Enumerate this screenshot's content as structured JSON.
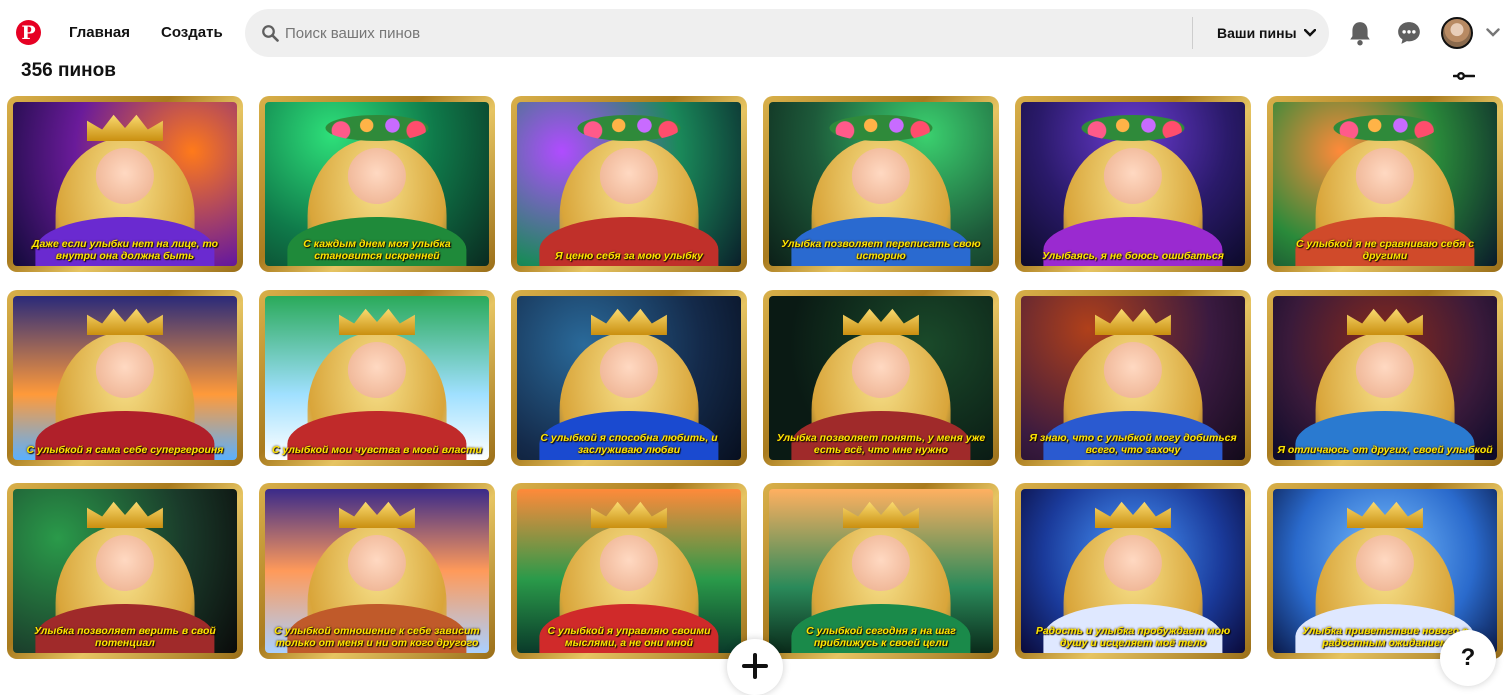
{
  "header": {
    "logo_icon": "pinterest-logo",
    "nav_home": "Главная",
    "nav_create": "Создать",
    "search_placeholder": "Поиск ваших пинов",
    "search_scope": "Ваши пины",
    "icons": [
      "bell-icon",
      "chat-icon",
      "avatar",
      "chevron-down-icon"
    ]
  },
  "board": {
    "pin_count": "356 пинов"
  },
  "pins": [
    {
      "caption": "Даже если улыбки нет на лице, то внутри она должна быть"
    },
    {
      "caption": "С каждым днем моя улыбка становится искренней"
    },
    {
      "caption": "Я ценю себя за мою улыбку"
    },
    {
      "caption": "Улыбка позволяет переписать свою историю"
    },
    {
      "caption": "Улыбаясь, я не боюсь ошибаться"
    },
    {
      "caption": "С улыбкой я не сравниваю себя с другими"
    },
    {
      "caption": "С улыбкой я сама себе супергероиня"
    },
    {
      "caption": "С улыбкой мои чувства в моей власти"
    },
    {
      "caption": "С улыбкой я способна любить, и заслуживаю любви"
    },
    {
      "caption": "Улыбка позволяет понять, у меня уже есть всё, что мне нужно"
    },
    {
      "caption": "Я знаю, что с улыбкой могу добиться всего, что захочу"
    },
    {
      "caption": "Я отличаюсь от других, своей улыбкой"
    },
    {
      "caption": "Улыбка позволяет верить в свой потенциал"
    },
    {
      "caption": "С улыбкой отношение к себе зависит только от меня и ни от кого другого"
    },
    {
      "caption": "С улыбкой я управляю своими мыслями, а не они мной"
    },
    {
      "caption": "С улыбкой сегодня я на шаг приближусь к своей цели"
    },
    {
      "caption": "Радость и улыбка пробуждает мою душу и исцеляет моё тело"
    },
    {
      "caption": "Улыбка приветствие нового с радостным ожиданием"
    }
  ],
  "fab": {
    "help_label": "?"
  }
}
